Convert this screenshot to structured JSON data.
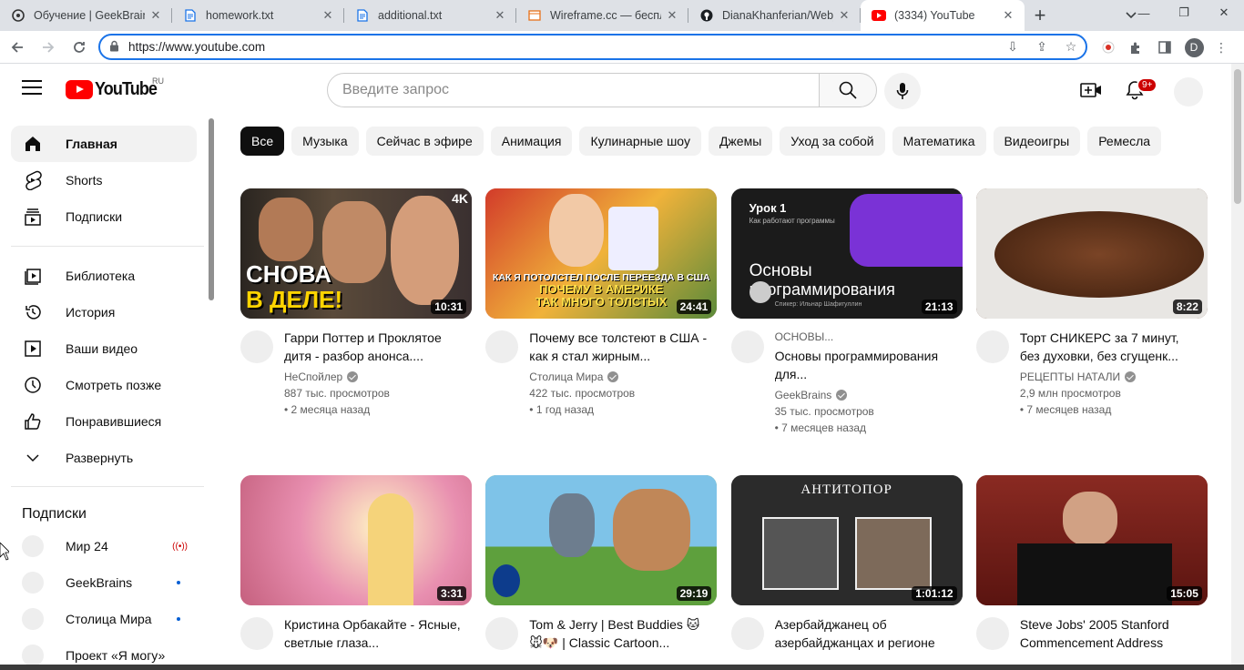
{
  "browser": {
    "tabs": [
      {
        "title": "Обучение | GeekBrains",
        "icon": "geekbrains-icon",
        "active": false
      },
      {
        "title": "homework.txt",
        "icon": "doc-icon",
        "active": false
      },
      {
        "title": "additional.txt",
        "icon": "doc-icon",
        "active": false
      },
      {
        "title": "Wireframe.cc — беспла",
        "icon": "wireframe-icon",
        "active": false
      },
      {
        "title": "DianaKhanferian/Web_",
        "icon": "github-icon",
        "active": false
      },
      {
        "title": "(3334) YouTube",
        "icon": "youtube-icon",
        "active": true
      }
    ],
    "url": "https://www.youtube.com",
    "profile_letter": "D"
  },
  "youtube": {
    "logo_text": "YouTube",
    "country_code": "RU",
    "search_placeholder": "Введите запрос",
    "notifications_badge": "9+",
    "sidebar": {
      "main": [
        {
          "label": "Главная",
          "icon": "home-icon",
          "active": true
        },
        {
          "label": "Shorts",
          "icon": "shorts-icon"
        },
        {
          "label": "Подписки",
          "icon": "subscriptions-icon"
        }
      ],
      "library": [
        {
          "label": "Библиотека",
          "icon": "library-icon"
        },
        {
          "label": "История",
          "icon": "history-icon"
        },
        {
          "label": "Ваши видео",
          "icon": "your-videos-icon"
        },
        {
          "label": "Смотреть позже",
          "icon": "watch-later-icon"
        },
        {
          "label": "Понравившиеся",
          "icon": "liked-icon"
        },
        {
          "label": "Развернуть",
          "icon": "chevron-down-icon"
        }
      ],
      "subscriptions_heading": "Подписки",
      "subscriptions": [
        {
          "label": "Мир 24",
          "indicator": "live"
        },
        {
          "label": "GeekBrains",
          "indicator": "new"
        },
        {
          "label": "Столица Мира",
          "indicator": "new"
        },
        {
          "label": "Проект «Я могу»",
          "indicator": ""
        }
      ]
    },
    "chips": [
      "Все",
      "Музыка",
      "Сейчас в эфире",
      "Анимация",
      "Кулинарные шоу",
      "Джемы",
      "Уход за собой",
      "Математика",
      "Видеоигры",
      "Ремесла"
    ],
    "videos": [
      {
        "title": "Гарри Поттер и Проклятое дитя - разбор анонса....",
        "channel": "НеСпойлер",
        "verified": true,
        "views": "887 тыс. просмотров",
        "age": "• 2 месяца назад",
        "duration": "10:31",
        "tag": "",
        "thumb_text": "СНОВА\nВ ДЕЛЕ!",
        "badge": "4K",
        "color": "#3a3a3a"
      },
      {
        "title": "Почему все толстеют в США - как я стал жирным...",
        "channel": "Столица Мира",
        "verified": true,
        "views": "422 тыс. просмотров",
        "age": "• 1 год назад",
        "duration": "24:41",
        "tag": "",
        "thumb_text": "КАК Я ПОТОЛСТЕЛ ПОСЛЕ ПЕРЕЕЗДА В США\nПОЧЕМУ В АМЕРИКЕ\nТАК МНОГО ТОЛСТЫХ",
        "color": "#c0392b"
      },
      {
        "title": "Основы программирования для...",
        "channel": "GeekBrains",
        "verified": true,
        "views": "35 тыс. просмотров",
        "age": "• 7 месяцев назад",
        "duration": "21:13",
        "tag": "ОСНОВЫ...",
        "thumb_text": "Урок 1\nКак работают программы\nОсновы\nпрограммирования\nСпикер: Ильнар Шафигуллин",
        "color": "#1b1b1b"
      },
      {
        "title": "Торт СНИКЕРС за 7 минут, без духовки, без сгущенк...",
        "channel": "РЕЦЕПТЫ НАТАЛИ",
        "verified": true,
        "views": "2,9 млн просмотров",
        "age": "• 7 месяцев назад",
        "duration": "8:22",
        "tag": "",
        "color": "#5a3018"
      },
      {
        "title": "Кристина Орбакайте - Ясные, светлые глаза...",
        "channel": "",
        "verified": false,
        "views": "",
        "age": "",
        "duration": "3:31",
        "tag": "",
        "color": "#e8a3b8"
      },
      {
        "title": "Tom & Jerry | Best Buddies 🐱🐭🐶 | Classic Cartoon...",
        "channel": "",
        "verified": false,
        "views": "",
        "age": "",
        "duration": "29:19",
        "tag": "",
        "color": "#6aa84f"
      },
      {
        "title": "Азербайджанец об азербайджанцах и регионе",
        "channel": "",
        "verified": false,
        "views": "",
        "age": "",
        "duration": "1:01:12",
        "tag": "",
        "thumb_text": "АНТИТОПОР",
        "color": "#2b2b2b"
      },
      {
        "title": "Steve Jobs' 2005 Stanford Commencement Address",
        "channel": "",
        "verified": false,
        "views": "",
        "age": "",
        "duration": "15:05",
        "tag": "",
        "color": "#7a1f1f"
      }
    ]
  }
}
